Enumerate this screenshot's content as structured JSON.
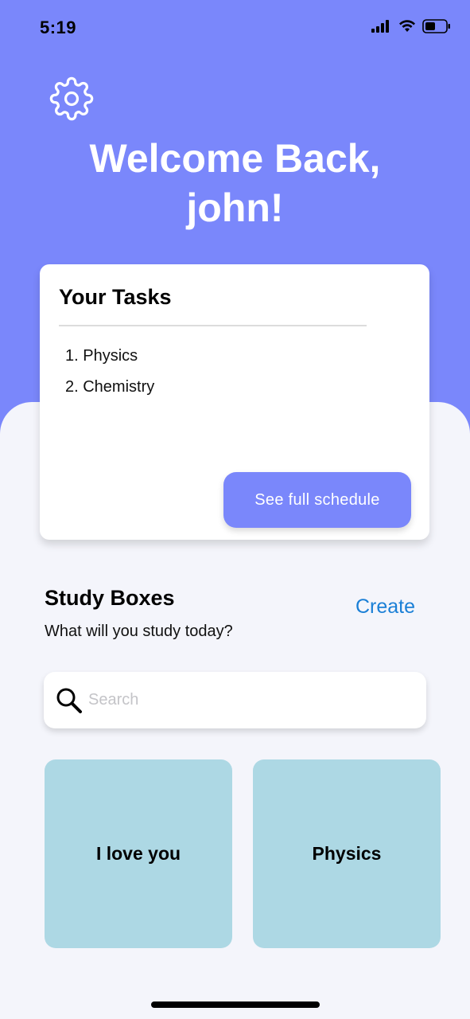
{
  "status_bar": {
    "time": "5:19",
    "icons": [
      "signal-icon",
      "wifi-icon",
      "battery-icon"
    ]
  },
  "header": {
    "settings_icon": "gear-icon",
    "welcome_line1": "Welcome Back,",
    "welcome_line2": "john!"
  },
  "tasks": {
    "title": "Your Tasks",
    "items": [
      "1. Physics",
      "2. Chemistry"
    ],
    "schedule_button": "See full schedule"
  },
  "study": {
    "title": "Study Boxes",
    "subtitle": "What will you study today?",
    "create_label": "Create",
    "search_placeholder": "Search",
    "search_value": "",
    "boxes": [
      {
        "label": "I love you"
      },
      {
        "label": "Physics"
      }
    ]
  },
  "colors": {
    "accent": "#7a87fb",
    "box": "#add8e4",
    "link": "#1a7fd6",
    "background": "#f4f5fb"
  }
}
